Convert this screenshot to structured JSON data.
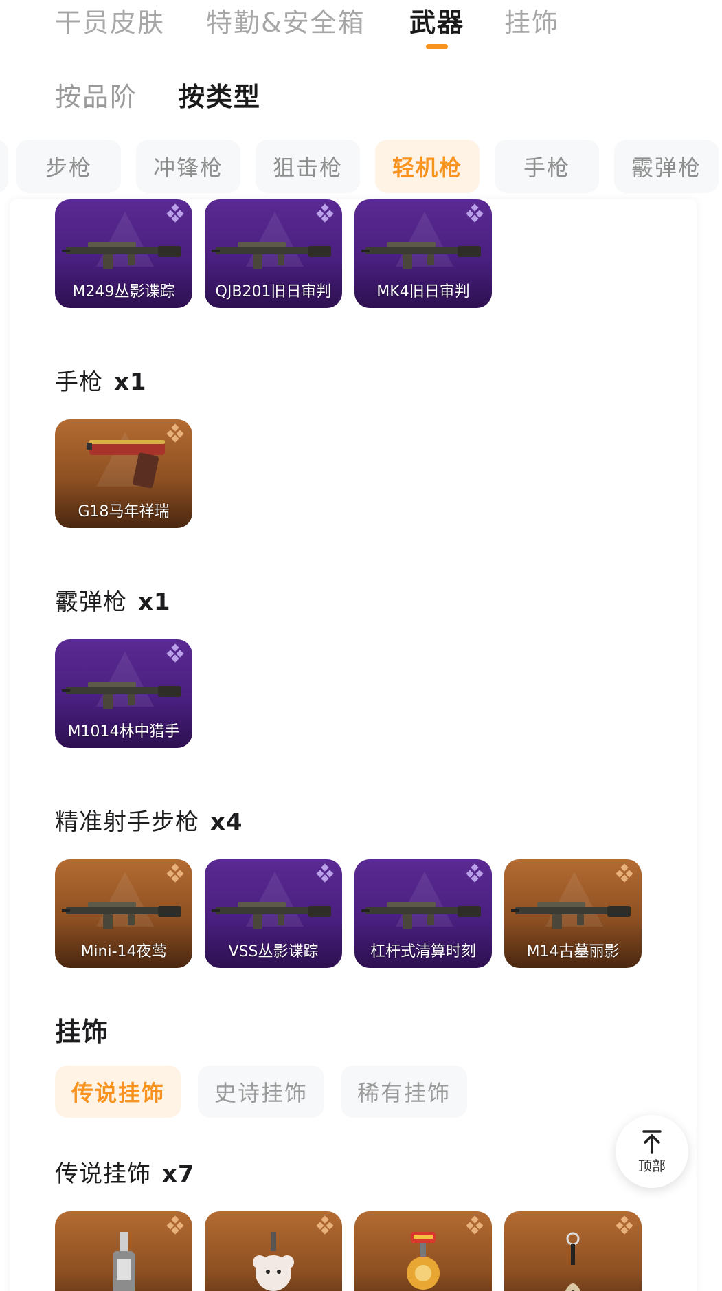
{
  "top_tabs": [
    {
      "label": "干员皮肤"
    },
    {
      "label": "特勤&安全箱"
    },
    {
      "label": "武器"
    },
    {
      "label": "挂饰"
    }
  ],
  "sub_tabs": [
    {
      "label": "按品阶"
    },
    {
      "label": "按类型"
    }
  ],
  "type_chips": [
    {
      "label": "步枪"
    },
    {
      "label": "冲锋枪"
    },
    {
      "label": "狙击枪"
    },
    {
      "label": "轻机枪"
    },
    {
      "label": "手枪"
    },
    {
      "label": "霰弹枪"
    }
  ],
  "lmg_items": [
    {
      "name": "M249丛影谍踪",
      "rarity": "purple"
    },
    {
      "name": "QJB201旧日审判",
      "rarity": "purple"
    },
    {
      "name": "MK4旧日审判",
      "rarity": "purple"
    }
  ],
  "pistol_section": {
    "title": "手枪",
    "count": "x1"
  },
  "pistol_items": [
    {
      "name": "G18马年祥瑞",
      "rarity": "orange"
    }
  ],
  "shotgun_section": {
    "title": "霰弹枪",
    "count": "x1"
  },
  "shotgun_items": [
    {
      "name": "M1014林中猎手",
      "rarity": "purple"
    }
  ],
  "dmr_section": {
    "title": "精准射手步枪",
    "count": "x4"
  },
  "dmr_items": [
    {
      "name": "Mini-14夜莺",
      "rarity": "orange"
    },
    {
      "name": "VSS丛影谍踪",
      "rarity": "purple"
    },
    {
      "name": "杠杆式清算时刻",
      "rarity": "purple"
    },
    {
      "name": "M14古墓丽影",
      "rarity": "orange"
    }
  ],
  "charms_heading": "挂饰",
  "charm_chips": [
    {
      "label": "传说挂饰"
    },
    {
      "label": "史诗挂饰"
    },
    {
      "label": "稀有挂饰"
    }
  ],
  "legendary_section": {
    "title": "传说挂饰",
    "count": "x7"
  },
  "legendary_items": [
    {
      "rarity": "orange"
    },
    {
      "rarity": "orange"
    },
    {
      "rarity": "orange"
    },
    {
      "rarity": "orange"
    }
  ],
  "to_top": {
    "label": "顶部"
  },
  "colors": {
    "accent": "#f7931e",
    "accent_bg": "#fff3e6",
    "epic_purple": "#5a2a92",
    "legendary_orange": "#b36b32",
    "chip_bg": "#f6f8f9"
  }
}
